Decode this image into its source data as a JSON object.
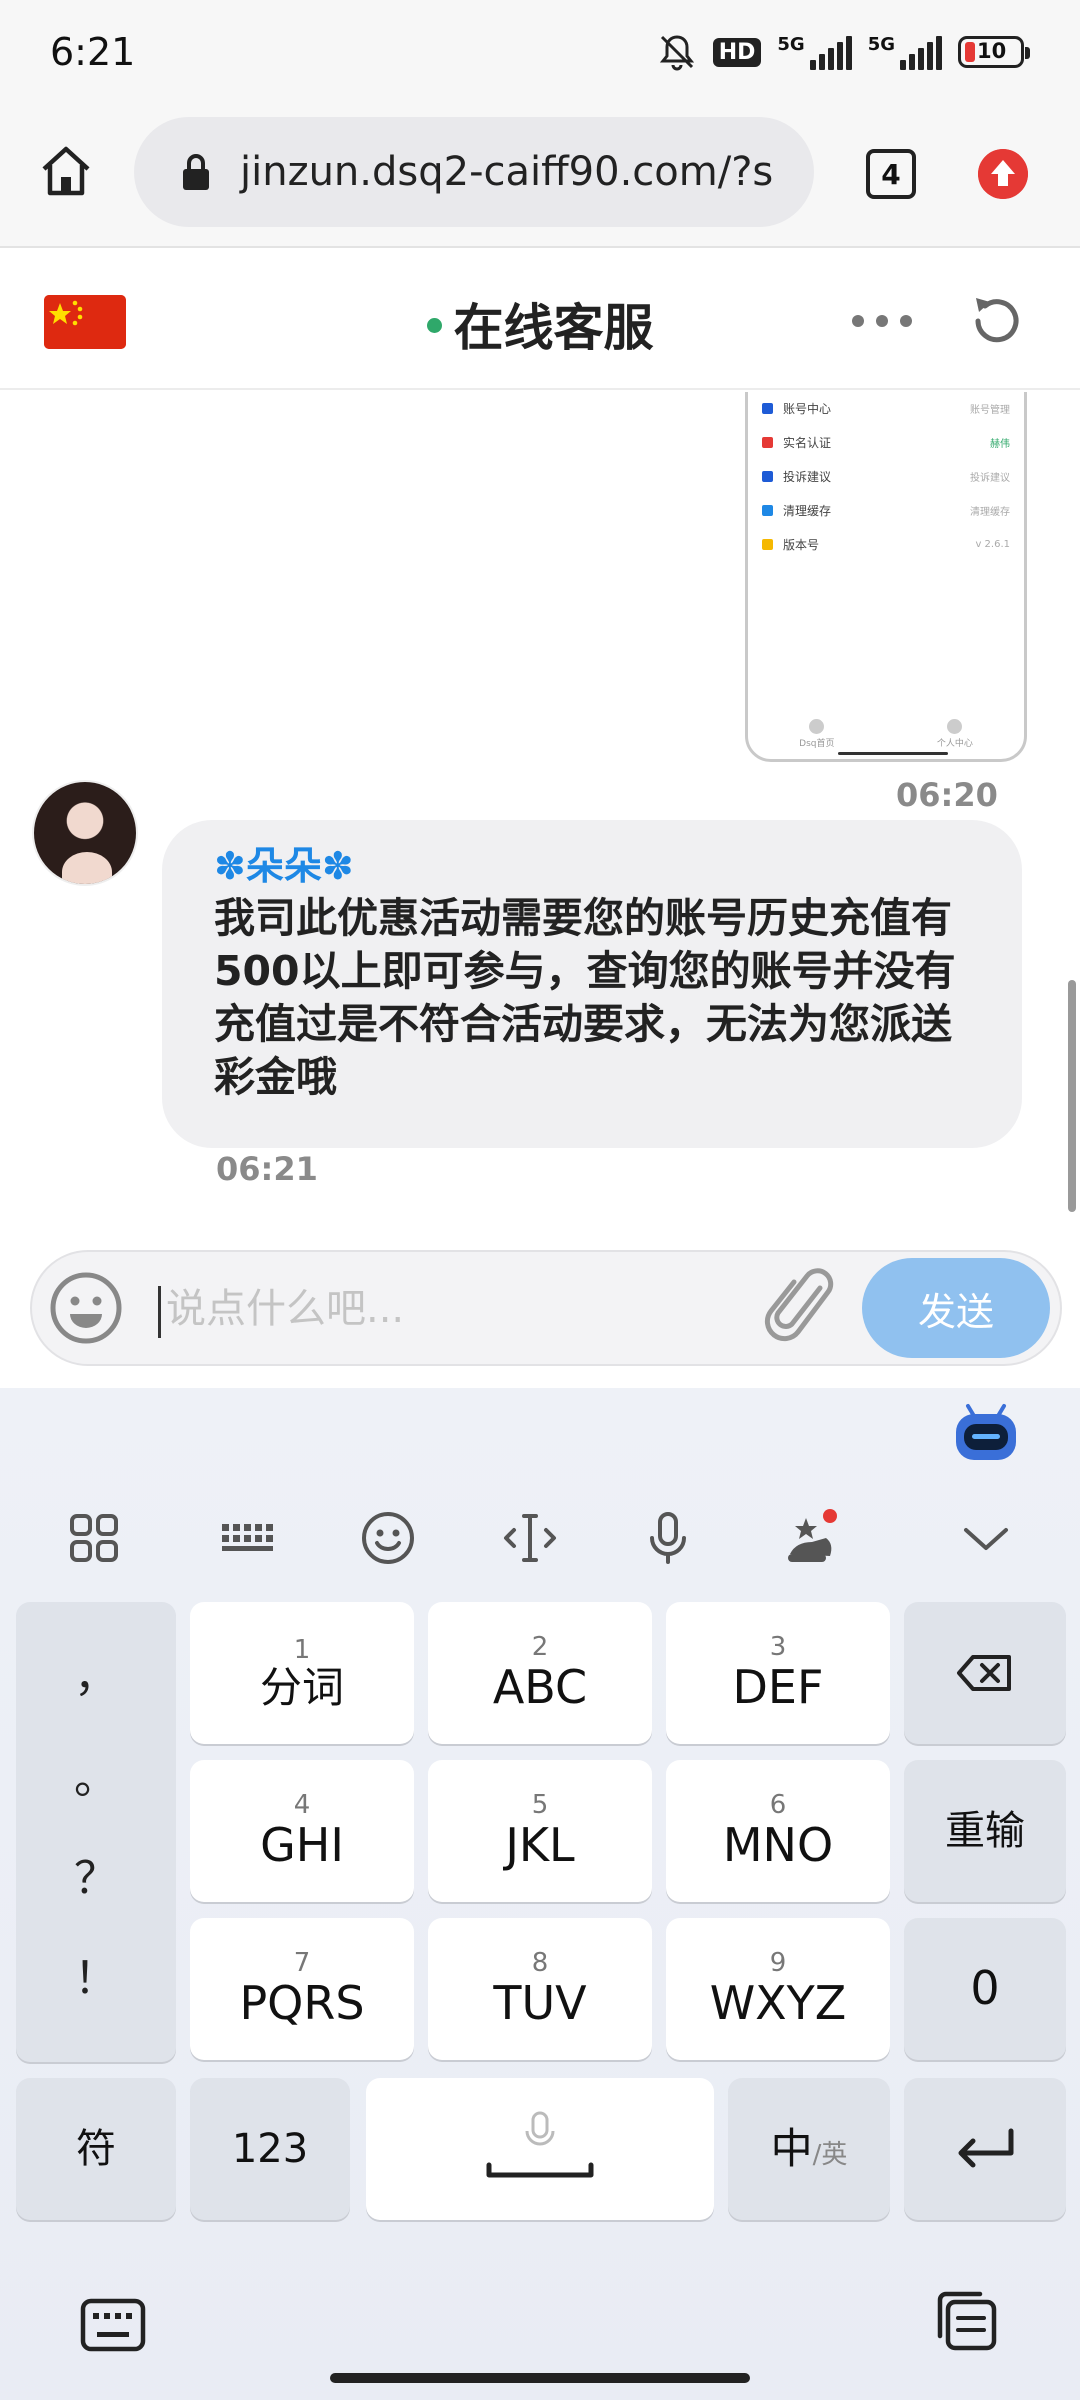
{
  "status_bar": {
    "time": "6:21",
    "hd_label": "HD",
    "network_1": "5G",
    "network_2": "5G",
    "battery": "10"
  },
  "browser": {
    "url": "jinzun.dsq2-caiff90.com/?s",
    "tab_count": "4"
  },
  "chat_header": {
    "title": "在线客服"
  },
  "chat": {
    "screenshot_rows": [
      {
        "label": "账号中心",
        "value": "账号管理",
        "color": "#1e5bd6"
      },
      {
        "label": "实名认证",
        "value": "赫伟",
        "color": "#e53935"
      },
      {
        "label": "投诉建议",
        "value": "投诉建议",
        "color": "#1e5bd6"
      },
      {
        "label": "清理缓存",
        "value": "清理缓存",
        "color": "#1e88e5"
      },
      {
        "label": "版本号",
        "value": "v 2.6.1",
        "color": "#f5b800"
      }
    ],
    "screenshot_nav": [
      "Dsq首页",
      "个人中心"
    ],
    "outgoing_time": "06:20",
    "agent_name": "✽朵朵✽",
    "incoming_message": "我司此优惠活动需要您的账号历史充值有500以上即可参与，查询您的账号并没有充值过是不符合活动要求，无法为您派送彩金哦",
    "incoming_time": "06:21"
  },
  "input": {
    "placeholder": "说点什么吧...",
    "send_label": "发送"
  },
  "keyboard": {
    "punctuation": [
      "，",
      "。",
      "？",
      "！"
    ],
    "keys": [
      {
        "num": "1",
        "label": "分词"
      },
      {
        "num": "2",
        "label": "ABC"
      },
      {
        "num": "3",
        "label": "DEF"
      },
      {
        "num": "4",
        "label": "GHI"
      },
      {
        "num": "5",
        "label": "JKL"
      },
      {
        "num": "6",
        "label": "MNO"
      },
      {
        "num": "7",
        "label": "PQRS"
      },
      {
        "num": "8",
        "label": "TUV"
      },
      {
        "num": "9",
        "label": "WXYZ"
      }
    ],
    "reinput_label": "重输",
    "zero_label": "0",
    "symbol_label": "符",
    "numeric_label": "123",
    "lang_main": "中",
    "lang_sub": "/英"
  },
  "colors": {
    "send_button": "#90c1ef",
    "online_dot": "#2fa86a",
    "agent_name": "#1e88e5"
  }
}
